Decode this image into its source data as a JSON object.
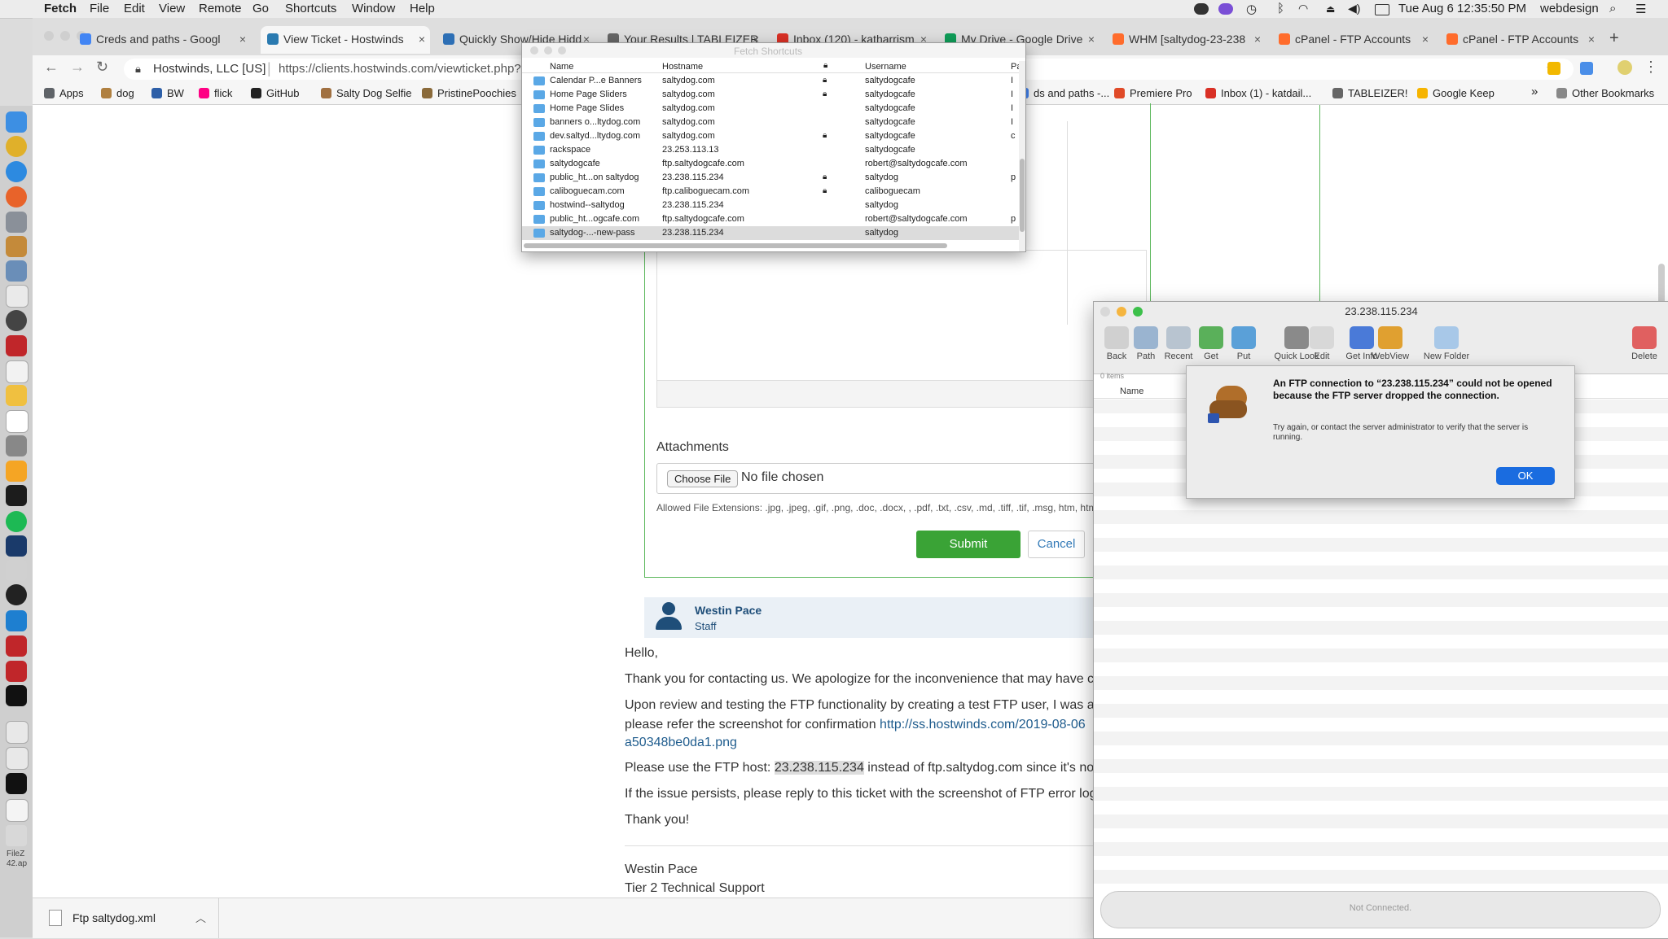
{
  "menubar": {
    "app_name": "Fetch",
    "items": [
      "File",
      "Edit",
      "View",
      "Remote",
      "Go",
      "Shortcuts",
      "Window",
      "Help"
    ],
    "clock": "Tue Aug 6  12:35:50 PM",
    "user": "webdesign"
  },
  "browser": {
    "tabs": [
      {
        "label": "Creds and paths - Googl",
        "color": "#4285f4"
      },
      {
        "label": "View Ticket - Hostwinds",
        "color": "#2a7ab0"
      },
      {
        "label": "Quickly Show/Hide Hidd",
        "color": "#2d6fb5"
      },
      {
        "label": "Your Results | TABLEIZER",
        "color": "#666666"
      },
      {
        "label": "Inbox (120) - katharrism",
        "color": "#d93025"
      },
      {
        "label": "My Drive - Google Drive",
        "color": "#0f9d58"
      },
      {
        "label": "WHM [saltydog-23-238",
        "color": "#ff6c2c"
      },
      {
        "label": "cPanel - FTP Accounts",
        "color": "#ff6c2c"
      },
      {
        "label": "cPanel - FTP Accounts",
        "color": "#ff6c2c"
      }
    ],
    "new_tab": "+",
    "site_identity": "Hostwinds, LLC [US]",
    "url": "https://clients.hostwinds.com/viewticket.php?t",
    "bookmarks": [
      {
        "label": "Apps",
        "color": "#5f6368"
      },
      {
        "label": "dog",
        "color": "#b08040"
      },
      {
        "label": "BW",
        "color": "#2d5fa8"
      },
      {
        "label": "flick",
        "color": "#ff0084"
      },
      {
        "label": "GitHub",
        "color": "#222222"
      },
      {
        "label": "Salty Dog Selfie",
        "color": "#a07040"
      },
      {
        "label": "PristinePoochies",
        "color": "#8a6a3a"
      }
    ],
    "bookmarks_right": [
      {
        "label": "ds and paths -...",
        "color": "#4285f4"
      },
      {
        "label": "Premiere Pro",
        "color": "#e04a28"
      },
      {
        "label": "Inbox (1) - katdail...",
        "color": "#d93025"
      },
      {
        "label": "TABLEIZER!",
        "color": "#666666"
      },
      {
        "label": "Google Keep",
        "color": "#f6b400"
      }
    ],
    "bookmarks_more": "»",
    "other_bookmarks": "Other Bookmarks",
    "download_file": "Ftp saltydog.xml"
  },
  "ticket": {
    "attachments_label": "Attachments",
    "choose_file": "Choose File",
    "no_file": "No file chosen",
    "allowed_ext": "Allowed File Extensions: .jpg, .jpeg, .gif, .png, .doc, .docx, , .pdf, .txt, .csv, .md, .tiff, .tif, .msg, htm, html",
    "submit": "Submit",
    "cancel": "Cancel",
    "author": "Westin Pace",
    "role": "Staff",
    "greeting": "Hello,",
    "para1": "Thank you for contacting us. We apologize for the inconvenience that may have c",
    "para2": "Upon review and testing the FTP functionality by creating a test FTP user, I was ab",
    "para3_text": "please refer the screenshot for confirmation ",
    "para3_link": "http://ss.hostwinds.com/2019-08-06",
    "para3_link2": "a50348be0da1.png",
    "para4_pre": "Please use the FTP host: ",
    "para4_host": "23.238.115.234",
    "para4_post": " instead of ftp.saltydog.com since it's no",
    "para5": "If the issue persists, please reply to this ticket with the screenshot of FTP error log",
    "thanks": "Thank you!",
    "sig_name": "Westin Pace",
    "sig_title": "Tier 2 Technical Support"
  },
  "shortcuts": {
    "title": "Fetch Shortcuts",
    "columns": [
      "Name",
      "Hostname",
      "Username",
      "Pat"
    ],
    "rows": [
      {
        "name": "Calendar P...e Banners",
        "host": "saltydog.com",
        "lock": true,
        "user": "saltydogcafe",
        "path": "I"
      },
      {
        "name": "Home Page Sliders",
        "host": "saltydog.com",
        "lock": true,
        "user": "saltydogcafe",
        "path": "I"
      },
      {
        "name": "Home Page Slides",
        "host": "saltydog.com",
        "lock": false,
        "user": "saltydogcafe",
        "path": "I"
      },
      {
        "name": "banners o...ltydog.com",
        "host": "saltydog.com",
        "lock": false,
        "user": "saltydogcafe",
        "path": "I"
      },
      {
        "name": "dev.saltyd...ltydog.com",
        "host": "saltydog.com",
        "lock": true,
        "user": "saltydogcafe",
        "path": "c"
      },
      {
        "name": "rackspace",
        "host": "23.253.113.13",
        "lock": false,
        "user": "saltydogcafe",
        "path": ""
      },
      {
        "name": "saltydogcafe",
        "host": "ftp.saltydogcafe.com",
        "lock": false,
        "user": "robert@saltydogcafe.com",
        "path": ""
      },
      {
        "name": "public_ht...on saltydog",
        "host": "23.238.115.234",
        "lock": true,
        "user": "saltydog",
        "path": "p"
      },
      {
        "name": "caliboguecam.com",
        "host": "ftp.caliboguecam.com",
        "lock": true,
        "user": "caliboguecam",
        "path": ""
      },
      {
        "name": "hostwind--saltydog",
        "host": "23.238.115.234",
        "lock": false,
        "user": "saltydog",
        "path": ""
      },
      {
        "name": "public_ht...ogcafe.com",
        "host": "ftp.saltydogcafe.com",
        "lock": false,
        "user": "robert@saltydogcafe.com",
        "path": "p"
      },
      {
        "name": "saltydog-...-new-pass",
        "host": "23.238.115.234",
        "lock": false,
        "user": "saltydog",
        "path": ""
      }
    ]
  },
  "fetch_window": {
    "title": "23.238.115.234",
    "toolbar": [
      "Back",
      "Path",
      "Recent",
      "Get",
      "Put",
      "Quick Look",
      "Edit",
      "Get Info",
      "WebView",
      "New Folder",
      "Delete"
    ],
    "item_count": "0 items",
    "name_column": "Name",
    "status": "Not Connected."
  },
  "alert": {
    "title": "An FTP connection to “23.238.115.234” could not be opened because the FTP server dropped the connection.",
    "message": "Try again, or contact the server administrator to verify that the server is running.",
    "ok": "OK"
  },
  "desktop": {
    "file_label": "FileZ 42.ap"
  },
  "colors": {
    "green_border": "#5cb85c",
    "submit_green": "#3aa336",
    "link_blue": "#205d8e",
    "ok_blue": "#1a6ce0"
  }
}
